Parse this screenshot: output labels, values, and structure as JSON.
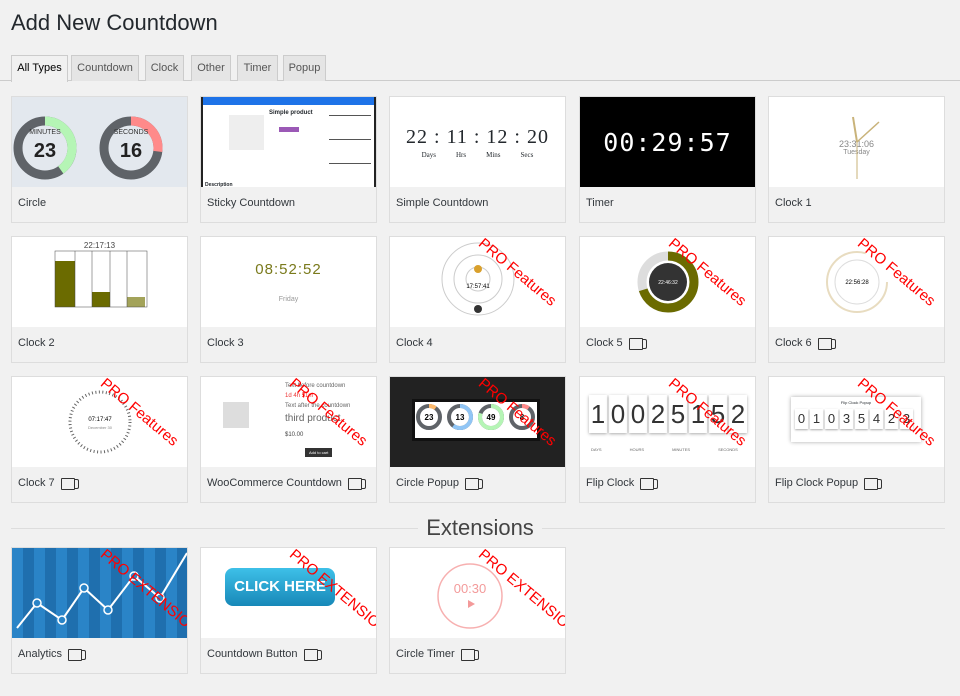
{
  "page_title": "Add New Countdown",
  "tabs": [
    {
      "label": "All Types",
      "active": true
    },
    {
      "label": "Countdown"
    },
    {
      "label": "Clock"
    },
    {
      "label": "Other"
    },
    {
      "label": "Timer"
    },
    {
      "label": "Popup"
    }
  ],
  "pro_label": "PRO Features",
  "pro_ext_label": "PRO EXTENSION",
  "types": [
    {
      "label": "Circle",
      "pro": false,
      "video": false
    },
    {
      "label": "Sticky Countdown",
      "pro": false,
      "video": false
    },
    {
      "label": "Simple Countdown",
      "pro": false,
      "video": false
    },
    {
      "label": "Timer",
      "pro": false,
      "video": false
    },
    {
      "label": "Clock 1",
      "pro": false,
      "video": false
    },
    {
      "label": "Clock 2",
      "pro": false,
      "video": false
    },
    {
      "label": "Clock 3",
      "pro": false,
      "video": false
    },
    {
      "label": "Clock 4",
      "pro": true,
      "video": false
    },
    {
      "label": "Clock 5",
      "pro": true,
      "video": true
    },
    {
      "label": "Clock 6",
      "pro": true,
      "video": true
    },
    {
      "label": "Clock 7",
      "pro": true,
      "video": true
    },
    {
      "label": "WooCommerce Countdown",
      "pro": true,
      "video": true
    },
    {
      "label": "Circle Popup",
      "pro": true,
      "video": true
    },
    {
      "label": "Flip Clock",
      "pro": true,
      "video": true
    },
    {
      "label": "Flip Clock Popup",
      "pro": true,
      "video": true
    }
  ],
  "extensions_heading": "Extensions",
  "extensions": [
    {
      "label": "Analytics"
    },
    {
      "label": "Countdown Button"
    },
    {
      "label": "Circle Timer"
    }
  ],
  "thumbs": {
    "circle": {
      "minutes_label": "MINUTES",
      "minutes": "23",
      "seconds_label": "SECONDS",
      "seconds": "16"
    },
    "sticky": {
      "product": "Simple product",
      "tab": "Description"
    },
    "simple": {
      "digits": [
        "22",
        "11",
        "12",
        "20"
      ],
      "units": [
        "Days",
        "Hrs",
        "Mins",
        "Secs"
      ]
    },
    "timer": "00:29:57",
    "clock1": {
      "time": "23:31:06",
      "day": "Tuesday"
    },
    "clock2": "22:17:13",
    "clock3": {
      "time": "08:52:52",
      "day": "Friday"
    },
    "clock4": "17:57:41",
    "clock5": "22:46:32",
    "clock6": "22:56:28",
    "clock7": {
      "time": "07:17:47",
      "date": "December 30"
    },
    "woo": {
      "l1": "Text before countdown",
      "l2": "1d 4h 51m",
      "l3": "Text after the countdown",
      "l4": "third product",
      "price": "$10.00",
      "button": "Add to cart"
    },
    "circle_popup": [
      "23",
      "13",
      "49",
      "8"
    ],
    "flip": [
      "1",
      "0",
      "0",
      "2",
      "5",
      "1",
      "5",
      "2"
    ],
    "flip_units": [
      "DAYS",
      "HOURS",
      "MINUTES",
      "SECONDS"
    ],
    "flip_popup_title": "Flip Clock Popup",
    "flip_popup": [
      "0",
      "1",
      "0",
      "3",
      "5",
      "4",
      "2",
      "3"
    ],
    "button_text": "CLICK HERE",
    "circle_timer": "00:30"
  },
  "colors": {
    "pro": "#ff0000",
    "accent_blue": "#1e73e8"
  }
}
